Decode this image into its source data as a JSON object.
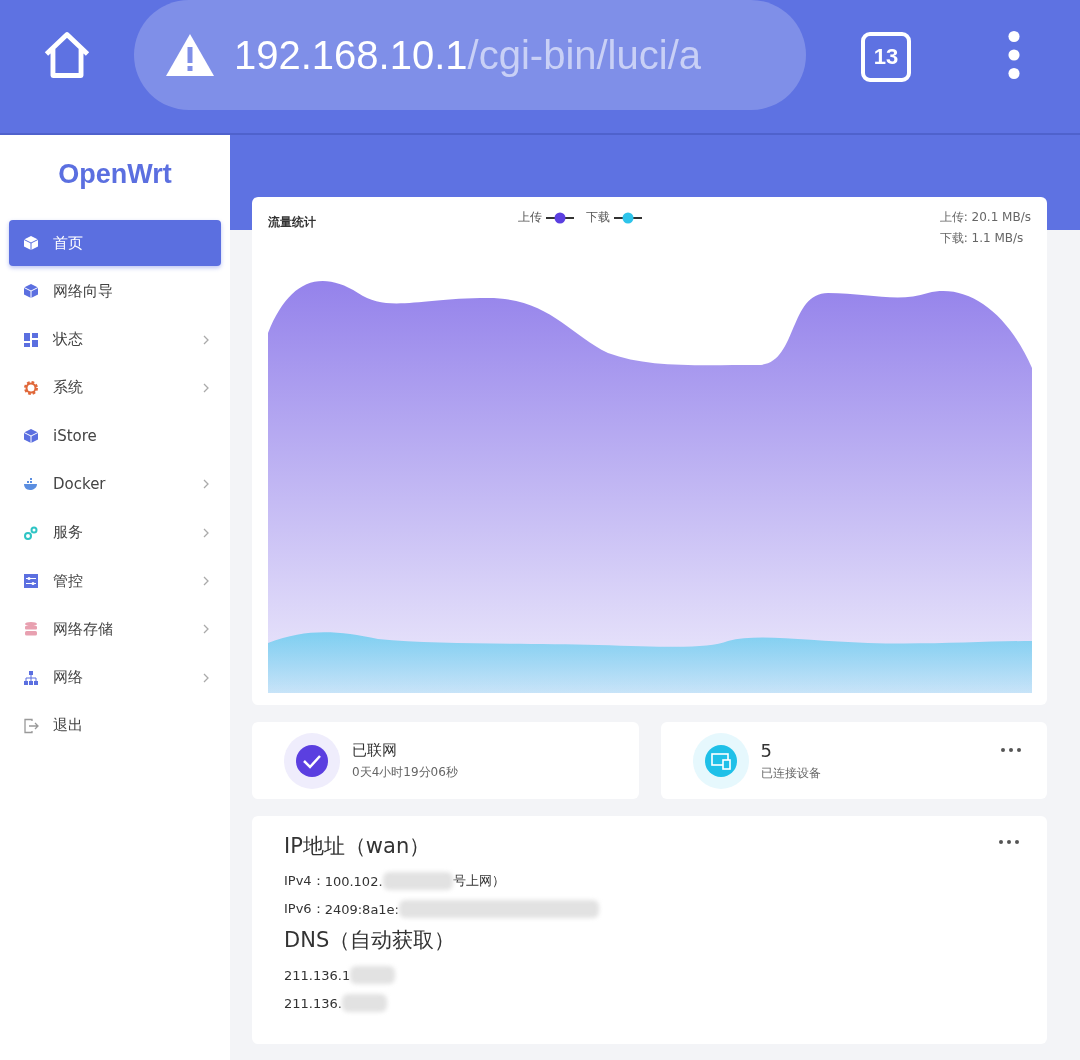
{
  "browser": {
    "url_host": "192.168.10.1",
    "url_path": "/cgi-bin/luci/a",
    "tab_count": "13"
  },
  "sidebar": {
    "logo": "OpenWrt",
    "items": [
      {
        "label": "首页",
        "kind": "cube",
        "selected": true,
        "expandable": false
      },
      {
        "label": "网络向导",
        "kind": "cube",
        "selected": false,
        "expandable": false
      },
      {
        "label": "状态",
        "kind": "dashboard",
        "selected": false,
        "expandable": true
      },
      {
        "label": "系统",
        "kind": "gear",
        "selected": false,
        "expandable": true
      },
      {
        "label": "iStore",
        "kind": "cube",
        "selected": false,
        "expandable": false
      },
      {
        "label": "Docker",
        "kind": "whale",
        "selected": false,
        "expandable": true
      },
      {
        "label": "服务",
        "kind": "gears",
        "selected": false,
        "expandable": true
      },
      {
        "label": "管控",
        "kind": "sliders",
        "selected": false,
        "expandable": true
      },
      {
        "label": "网络存储",
        "kind": "database",
        "selected": false,
        "expandable": true
      },
      {
        "label": "网络",
        "kind": "network",
        "selected": false,
        "expandable": true
      },
      {
        "label": "退出",
        "kind": "logout",
        "selected": false,
        "expandable": false
      }
    ]
  },
  "traffic": {
    "title": "流量统计",
    "legend": [
      {
        "label": "上传",
        "color": "#5b3fe0"
      },
      {
        "label": "下载",
        "color": "#2ec4ea"
      }
    ],
    "upload_rate": "上传: 20.1 MB/s",
    "download_rate": "下载: 1.1 MB/s"
  },
  "status_cards": [
    {
      "kind": "network",
      "title": "已联网",
      "subtitle": "0天4小时19分06秒",
      "has_menu": false
    },
    {
      "kind": "devices",
      "title": "5",
      "subtitle": "已连接设备",
      "has_menu": true
    }
  ],
  "ip_card": {
    "title": "IP地址（wan）",
    "ipv4_label": "IPv4：",
    "ipv4_value": "100.102.",
    "ipv4_suffix": "号上网）",
    "ipv6_label": "IPv6：",
    "ipv6_value": "2409:8a1e:",
    "dns_title": "DNS（自动获取）",
    "dns": [
      "211.136.1",
      "211.136."
    ]
  }
}
